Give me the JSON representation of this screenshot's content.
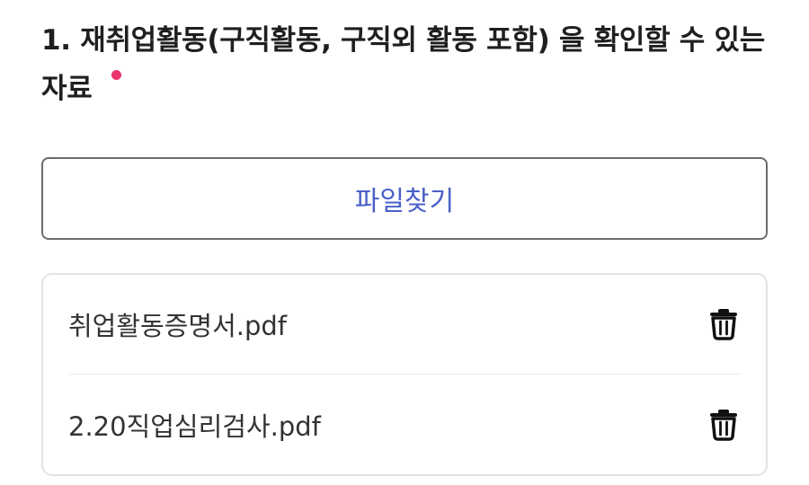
{
  "question": {
    "number_and_text": "1. 재취업활동(구직활동, 구직외 활동 포함) 을 확인할 수 있는 자료"
  },
  "upload": {
    "button_label": "파일찾기"
  },
  "files": [
    {
      "name": "취업활동증명서.pdf"
    },
    {
      "name": "2.20직업심리검사.pdf"
    }
  ],
  "colors": {
    "required_dot": "#e8336b",
    "button_text": "#4a60c8"
  },
  "icons": {
    "delete": "trash-icon"
  }
}
